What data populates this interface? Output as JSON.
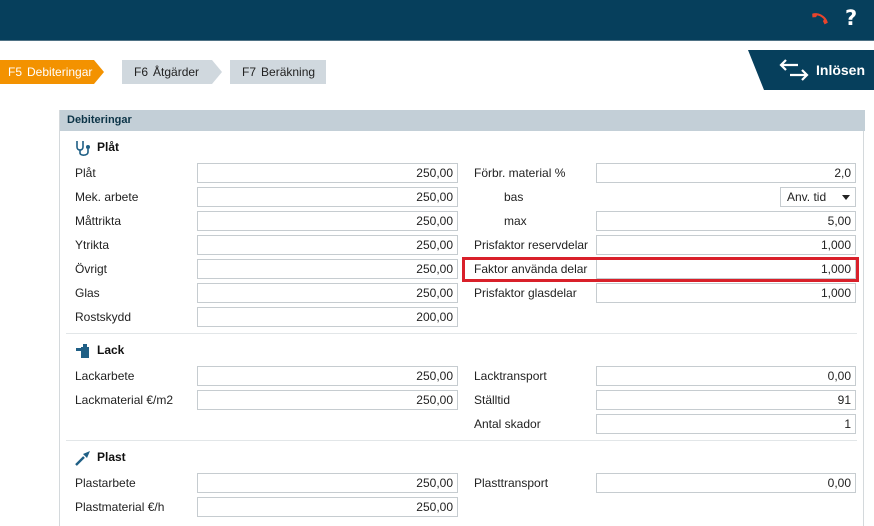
{
  "header": {
    "help_label": "?"
  },
  "tabs": [
    {
      "key": "F5",
      "label": "Debiteringar"
    },
    {
      "key": "F6",
      "label": "Åtgärder"
    },
    {
      "key": "F7",
      "label": "Beräkning"
    }
  ],
  "inlosen": {
    "label": "Inlösen"
  },
  "panel": {
    "title": "Debiteringar"
  },
  "plat": {
    "title": "Plåt",
    "left": [
      {
        "label": "Plåt",
        "value": "250,00"
      },
      {
        "label": "Mek. arbete",
        "value": "250,00"
      },
      {
        "label": "Måttrikta",
        "value": "250,00"
      },
      {
        "label": "Ytrikta",
        "value": "250,00"
      },
      {
        "label": "Övrigt",
        "value": "250,00"
      },
      {
        "label": "Glas",
        "value": "250,00"
      },
      {
        "label": "Rostskydd",
        "value": "200,00"
      }
    ],
    "right": {
      "forbr_label": "Förbr. material %",
      "forbr_value": "2,0",
      "bas_label": "bas",
      "bas_value": "Anv. tid",
      "max_label": "max",
      "max_value": "5,00",
      "reserv_label": "Prisfaktor reservdelar",
      "reserv_value": "1,000",
      "anvanda_label": "Faktor använda delar",
      "anvanda_value": "1,000",
      "glas_label": "Prisfaktor glasdelar",
      "glas_value": "1,000"
    }
  },
  "lack": {
    "title": "Lack",
    "left": [
      {
        "label": "Lackarbete",
        "value": "250,00"
      },
      {
        "label": "Lackmaterial €/m2",
        "value": "250,00"
      }
    ],
    "right": [
      {
        "label": "Lacktransport",
        "value": "0,00"
      },
      {
        "label": "Ställtid",
        "value": "91"
      },
      {
        "label": "Antal skador",
        "value": "1"
      }
    ]
  },
  "plast": {
    "title": "Plast",
    "left": [
      {
        "label": "Plastarbete",
        "value": "250,00"
      },
      {
        "label": "Plastmaterial €/h",
        "value": "250,00"
      }
    ],
    "right": [
      {
        "label": "Plasttransport",
        "value": "0,00"
      }
    ]
  },
  "colors": {
    "topbar": "#063f5c",
    "active_tab": "#f39200",
    "highlight": "#d9202a"
  }
}
